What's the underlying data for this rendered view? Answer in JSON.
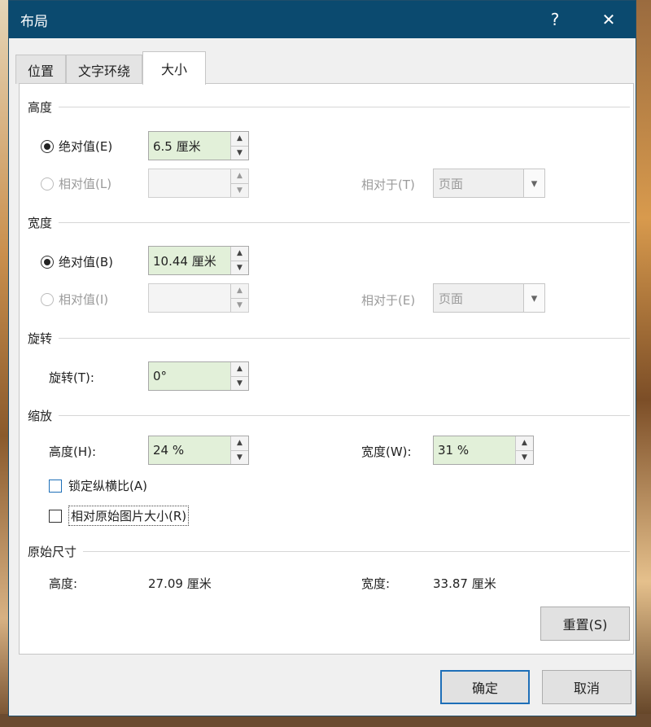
{
  "window": {
    "title": "布局",
    "help_label": "?",
    "close_label": "✕"
  },
  "tabs": [
    {
      "label": "位置",
      "active": false
    },
    {
      "label": "文字环绕",
      "active": false
    },
    {
      "label": "大小",
      "active": true
    }
  ],
  "height_section": {
    "title": "高度",
    "absolute_label": "绝对值(E)",
    "absolute_value": "6.5 厘米",
    "relative_label": "相对值(L)",
    "relative_value": "",
    "relative_to_label": "相对于(T)",
    "relative_to_value": "页面"
  },
  "width_section": {
    "title": "宽度",
    "absolute_label": "绝对值(B)",
    "absolute_value": "10.44 厘米",
    "relative_label": "相对值(I)",
    "relative_value": "",
    "relative_to_label": "相对于(E)",
    "relative_to_value": "页面"
  },
  "rotate_section": {
    "title": "旋转",
    "rotate_label": "旋转(T):",
    "rotate_value": "0°"
  },
  "scale_section": {
    "title": "缩放",
    "height_label": "高度(H):",
    "height_value": "24 %",
    "width_label": "宽度(W):",
    "width_value": "31 %",
    "lock_ratio_label": "锁定纵横比(A)",
    "relative_original_label": "相对原始图片大小(R)"
  },
  "original_section": {
    "title": "原始尺寸",
    "height_label": "高度:",
    "height_value": "27.09 厘米",
    "width_label": "宽度:",
    "width_value": "33.87 厘米"
  },
  "buttons": {
    "reset": "重置(S)",
    "ok": "确定",
    "cancel": "取消"
  },
  "colors": {
    "titlebar": "#0b4a6f",
    "field_fill": "#e2f0d9",
    "accent": "#1e6fb8"
  }
}
